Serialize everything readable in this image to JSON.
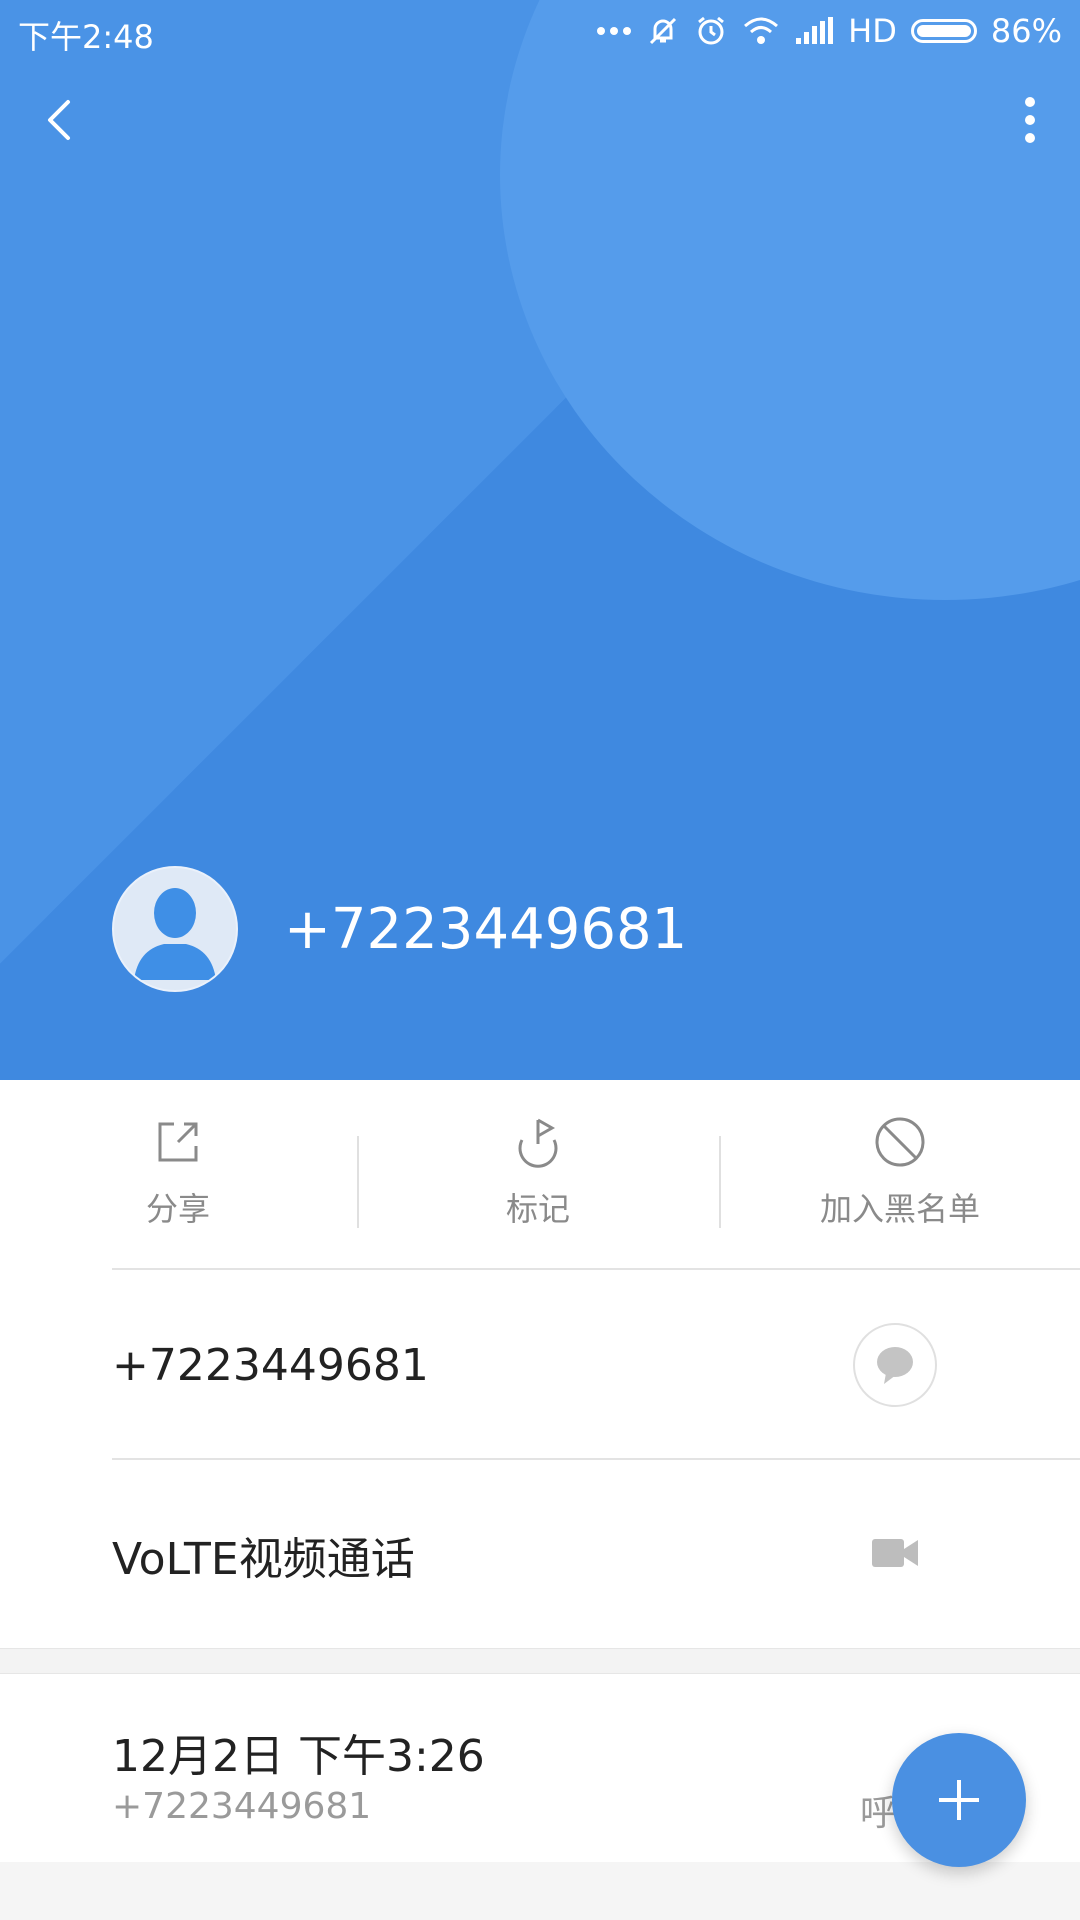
{
  "status_bar": {
    "time": "下午2:48",
    "network": "HD",
    "battery": "86%"
  },
  "header": {
    "phone_number": "+7223449681"
  },
  "actions": [
    {
      "label": "分享",
      "icon": "share-icon"
    },
    {
      "label": "标记",
      "icon": "flag-icon"
    },
    {
      "label": "加入黑名单",
      "icon": "block-icon"
    }
  ],
  "rows": {
    "number": "+7223449681",
    "video_call": "VoLTE视频通话"
  },
  "history": {
    "date": "12月2日 下午3:26",
    "number": "+7223449681",
    "type": "呼"
  },
  "colors": {
    "hero": "#3b86dd",
    "fab": "#4a90e2"
  }
}
